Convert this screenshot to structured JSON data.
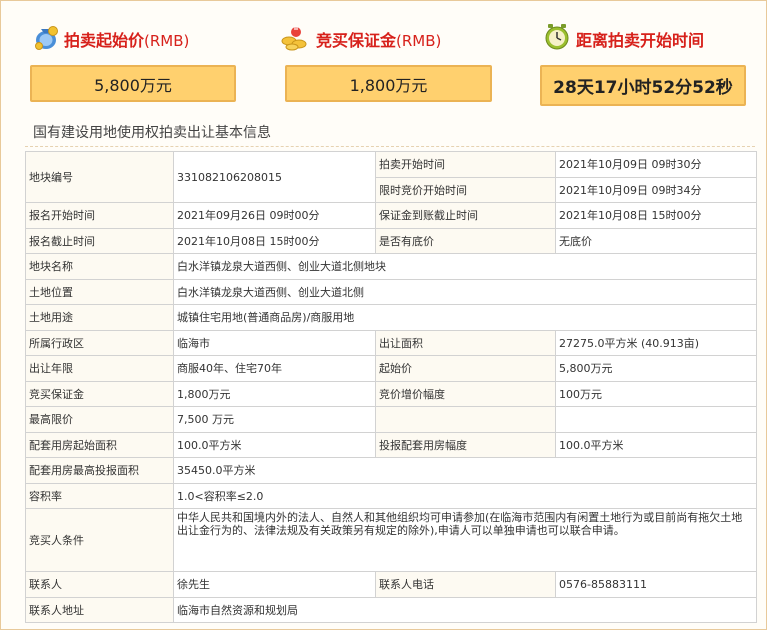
{
  "header": {
    "start_price": {
      "label": "拍卖起始价",
      "unit": "(RMB)",
      "value": "5,800万元",
      "icon": "money-bag-icon"
    },
    "deposit": {
      "label": "竞买保证金",
      "unit": "(RMB)",
      "value": "1,800万元",
      "icon": "coins-icon"
    },
    "countdown": {
      "label": "距离拍卖开始时间",
      "value": "28天17小时52分52秒",
      "icon": "clock-icon"
    }
  },
  "section_title": "国有建设用地使用权拍卖出让基本信息",
  "table": {
    "parcel_no_label": "地块编号",
    "parcel_no": "331082106208015",
    "auction_start_label": "拍卖开始时间",
    "auction_start": "2021年10月09日 09时30分",
    "bid_start_label": "限时竞价开始时间",
    "bid_start": "2021年10月09日 09时34分",
    "reg_start_label": "报名开始时间",
    "reg_start": "2021年09月26日 09时00分",
    "deposit_deadline_label": "保证金到账截止时间",
    "deposit_deadline": "2021年10月08日 15时00分",
    "reg_end_label": "报名截止时间",
    "reg_end": "2021年10月08日 15时00分",
    "reserve_label": "是否有底价",
    "reserve": "无底价",
    "name_label": "地块名称",
    "name": "白水洋镇龙泉大道西侧、创业大道北侧地块",
    "location_label": "土地位置",
    "location": "白水洋镇龙泉大道西侧、创业大道北侧",
    "usage_label": "土地用途",
    "usage": "城镇住宅用地(普通商品房)/商服用地",
    "district_label": "所属行政区",
    "district": "临海市",
    "area_label": "出让面积",
    "area": "27275.0平方米 (40.913亩)",
    "term_label": "出让年限",
    "term": "商服40年、住宅70年",
    "start_price_label": "起始价",
    "start_price": "5,800万元",
    "bid_deposit_label": "竞买保证金",
    "bid_deposit": "1,800万元",
    "increment_label": "竞价增价幅度",
    "increment": "100万元",
    "max_price_label": "最高限价",
    "max_price": "7,500 万元",
    "housing_start_label": "配套用房起始面积",
    "housing_start": "100.0平方米",
    "housing_inc_label": "投报配套用房幅度",
    "housing_inc": "100.0平方米",
    "housing_max_label": "配套用房最高投报面积",
    "housing_max": "35450.0平方米",
    "far_label": "容积率",
    "far": "1.0<容积率≤2.0",
    "conditions_label": "竞买人条件",
    "conditions": "中华人民共和国境内外的法人、自然人和其他组织均可申请参加(在临海市范围内有闲置土地行为或目前尚有拖欠土地出让金行为的、法律法规及有关政策另有规定的除外),申请人可以单独申请也可以联合申请。",
    "contact_label": "联系人",
    "contact": "徐先生",
    "phone_label": "联系人电话",
    "phone": "0576-85883111",
    "address_label": "联系人地址",
    "address": "临海市自然资源和规划局"
  },
  "colors": {
    "accent_red": "#d7211b",
    "box_fill": "#ffd06e",
    "box_border": "#ebb354"
  }
}
